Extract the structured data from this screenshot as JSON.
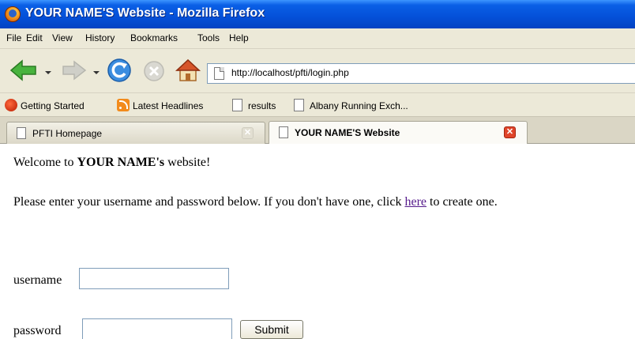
{
  "window": {
    "title": "YOUR NAME'S Website - Mozilla Firefox"
  },
  "menubar": {
    "items": [
      "File",
      "Edit",
      "View",
      "History",
      "Bookmarks",
      "Tools",
      "Help"
    ]
  },
  "navigation": {
    "url": "http://localhost/pfti/login.php",
    "icons": [
      "back-arrow-icon",
      "forward-arrow-icon",
      "reload-icon",
      "stop-icon",
      "home-icon",
      "page-icon"
    ]
  },
  "bookmarks": {
    "items": [
      {
        "label": "Getting Started",
        "icon": "firefox-icon"
      },
      {
        "label": "Latest Headlines",
        "icon": "rss-icon"
      },
      {
        "label": "results",
        "icon": "page-icon"
      },
      {
        "label": "Albany Running Exch...",
        "icon": "page-icon"
      }
    ]
  },
  "tabs": [
    {
      "label": "PFTI Homepage",
      "active": false
    },
    {
      "label": "YOUR NAME'S Website",
      "active": true
    }
  ],
  "page": {
    "welcome_prefix": "Welcome to ",
    "welcome_name": "YOUR NAME",
    "welcome_suffix_bold": "'s",
    "welcome_suffix": " website!",
    "instructions_prefix": "Please enter your username and password below. If you don't have one, click ",
    "instructions_link": "here",
    "instructions_suffix": " to create one.",
    "username_label": "username",
    "username_value": "",
    "password_label": "password",
    "password_value": "",
    "submit_label": "Submit"
  },
  "colors": {
    "titlebar": "#0450d8",
    "chrome": "#ece9d8",
    "link_visited": "#551a8b",
    "tab_close_active": "#e0452b"
  }
}
